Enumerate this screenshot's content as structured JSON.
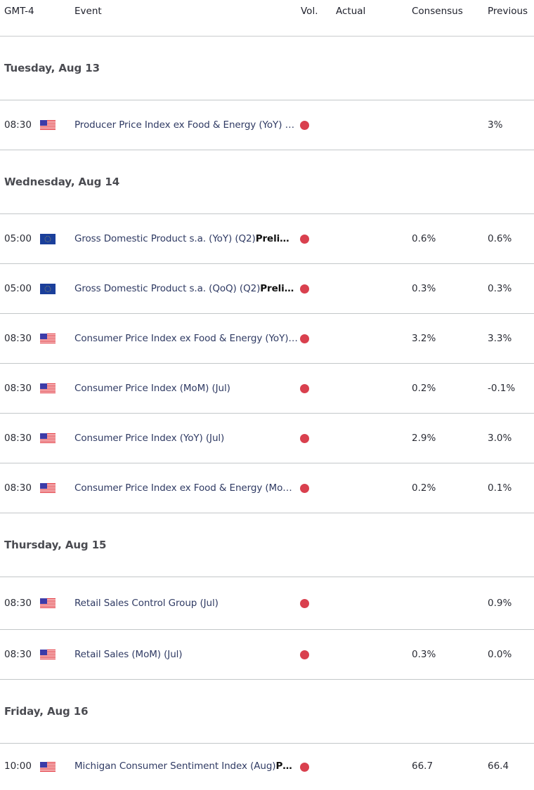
{
  "header": {
    "timezone": "GMT-4",
    "event": "Event",
    "vol": "Vol.",
    "actual": "Actual",
    "consensus": "Consensus",
    "previous": "Previous"
  },
  "colors": {
    "volatility_high": "#d9404e",
    "event_text": "#2f3a63",
    "separator": "#c3c7c9"
  },
  "days": [
    {
      "label": "Tuesday, Aug 13",
      "events": [
        {
          "time": "08:30",
          "country": "us-flag-icon",
          "name": "Producer Price Index ex Food & Energy (YoY) (Jul)",
          "suffix": "",
          "volatility": "high",
          "actual": "",
          "consensus": "",
          "previous": "3%"
        }
      ]
    },
    {
      "label": "Wednesday, Aug 14",
      "events": [
        {
          "time": "05:00",
          "country": "eu-flag-icon",
          "name": "Gross Domestic Product s.a. (YoY) (Q2)",
          "suffix": "Preli…",
          "volatility": "high",
          "actual": "",
          "consensus": "0.6%",
          "previous": "0.6%"
        },
        {
          "time": "05:00",
          "country": "eu-flag-icon",
          "name": "Gross Domestic Product s.a. (QoQ) (Q2)",
          "suffix": "Preli…",
          "volatility": "high",
          "actual": "",
          "consensus": "0.3%",
          "previous": "0.3%"
        },
        {
          "time": "08:30",
          "country": "us-flag-icon",
          "name": "Consumer Price Index ex Food & Energy (YoY) (Jul)",
          "suffix": "",
          "volatility": "high",
          "actual": "",
          "consensus": "3.2%",
          "previous": "3.3%"
        },
        {
          "time": "08:30",
          "country": "us-flag-icon",
          "name": "Consumer Price Index (MoM) (Jul)",
          "suffix": "",
          "volatility": "high",
          "actual": "",
          "consensus": "0.2%",
          "previous": "-0.1%"
        },
        {
          "time": "08:30",
          "country": "us-flag-icon",
          "name": "Consumer Price Index (YoY) (Jul)",
          "suffix": "",
          "volatility": "high",
          "actual": "",
          "consensus": "2.9%",
          "previous": "3.0%"
        },
        {
          "time": "08:30",
          "country": "us-flag-icon",
          "name": "Consumer Price Index ex Food & Energy (MoM) (Jul)",
          "suffix": "",
          "volatility": "high",
          "actual": "",
          "consensus": "0.2%",
          "previous": "0.1%"
        }
      ]
    },
    {
      "label": "Thursday, Aug 15",
      "events": [
        {
          "time": "08:30",
          "country": "us-flag-icon",
          "name": "Retail Sales Control Group (Jul)",
          "suffix": "",
          "volatility": "high",
          "actual": "",
          "consensus": "",
          "previous": "0.9%"
        },
        {
          "time": "08:30",
          "country": "us-flag-icon",
          "name": "Retail Sales (MoM) (Jul)",
          "suffix": "",
          "volatility": "high",
          "actual": "",
          "consensus": "0.3%",
          "previous": "0.0%"
        }
      ]
    },
    {
      "label": "Friday, Aug 16",
      "events": [
        {
          "time": "10:00",
          "country": "us-flag-icon",
          "name": "Michigan Consumer Sentiment Index (Aug)",
          "suffix": "P…",
          "volatility": "high",
          "actual": "",
          "consensus": "66.7",
          "previous": "66.4"
        }
      ]
    }
  ]
}
